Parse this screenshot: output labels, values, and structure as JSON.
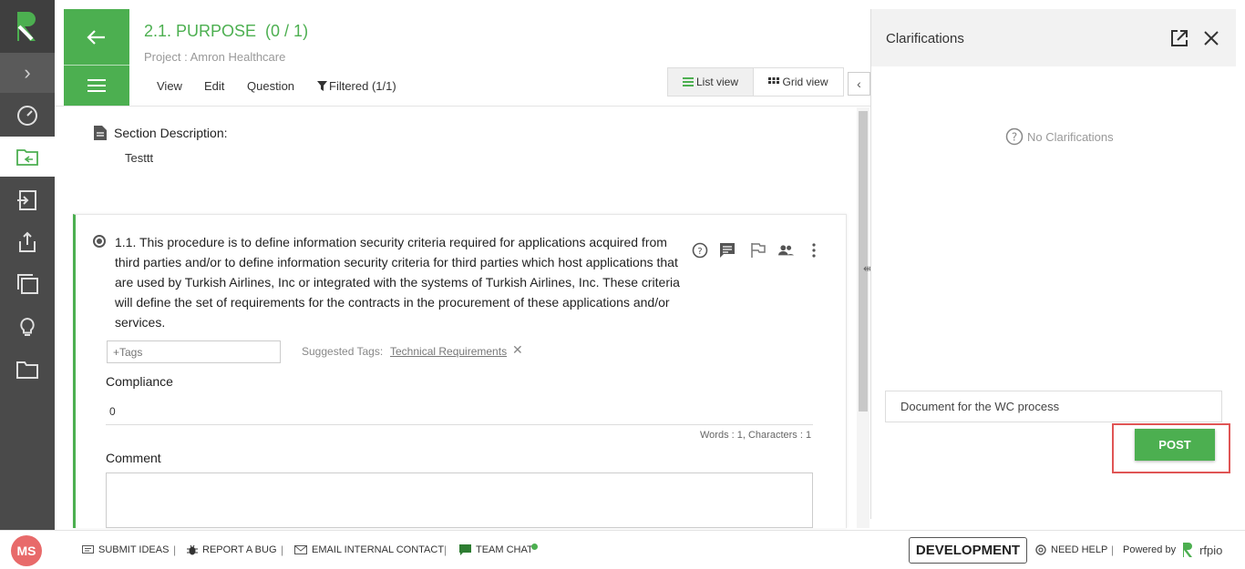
{
  "header": {
    "title": "2.1. PURPOSE",
    "count": "(0 / 1)",
    "project": "Project : Amron Healthcare",
    "tabs": [
      {
        "label": "View"
      },
      {
        "label": "Edit"
      },
      {
        "label": "Question"
      },
      {
        "label": "Filtered (1/1)"
      }
    ],
    "list_view": "List view",
    "grid_view": "Grid view"
  },
  "section": {
    "desc_label": "Section Description:",
    "desc_value": "Testtt"
  },
  "question": {
    "text": "1.1. This procedure is to define information security criteria required for applications acquired from third parties and/or to define information security criteria for third parties which host applications that are used by Turkish Airlines, Inc or integrated with the systems of Turkish Airlines, Inc. These criteria will define the set of requirements for the contracts in the procurement of these applications and/or services.",
    "tags_placeholder": "+Tags",
    "suggested_label": "Suggested Tags:",
    "suggested_tag": "Technical Requirements",
    "compliance_label": "Compliance",
    "compliance_value": "0",
    "word_count": "Words : 1, Characters : 1",
    "comment_label": "Comment"
  },
  "clarifications": {
    "title": "Clarifications",
    "empty": "No Clarifications",
    "input_value": "Document for the WC process",
    "post": "POST"
  },
  "footer": {
    "avatar": "MS",
    "submit_ideas": "SUBMIT IDEAS",
    "report_bug": "REPORT A BUG",
    "email_contact": "EMAIL INTERNAL CONTACT",
    "team_chat": "TEAM CHAT",
    "env": "DEVELOPMENT",
    "need_help": "NEED HELP",
    "powered_by": "Powered by",
    "brand": "rfpio"
  },
  "colors": {
    "accent": "#4caf50",
    "sidebar": "#4a4a4a",
    "highlight": "#e05555"
  }
}
